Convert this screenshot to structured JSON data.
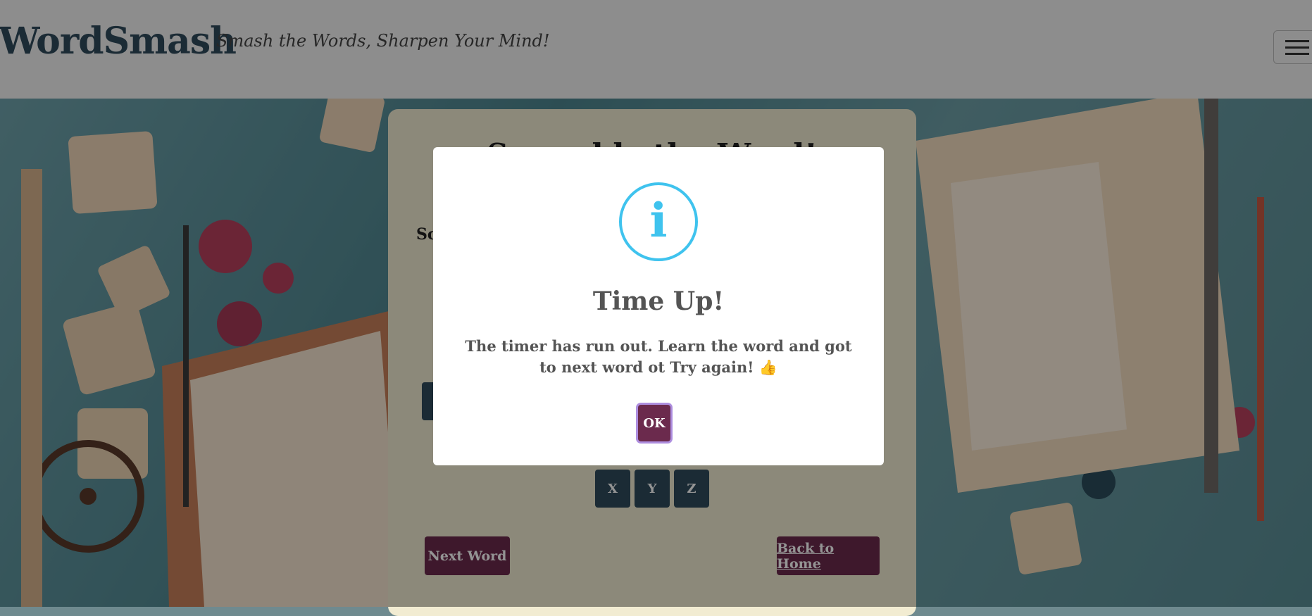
{
  "header": {
    "brand": "WordSmash",
    "tagline": "Smash the Words, Sharpen Your Mind!"
  },
  "game": {
    "title": "Scramble the Word!",
    "score_label": "Sc",
    "letters": [
      "X",
      "Y",
      "Z"
    ],
    "next_word_label": "Next Word",
    "back_home_label": "Back to Home"
  },
  "dialog": {
    "icon": "info-icon",
    "icon_glyph": "i",
    "title": "Time Up!",
    "message": "The timer has run out. Learn the word and got to next word ot Try again! 👍",
    "ok_label": "OK"
  },
  "colors": {
    "brand": "#2f4a5c",
    "accent": "#6b2a4d",
    "info": "#3fc3ee"
  }
}
